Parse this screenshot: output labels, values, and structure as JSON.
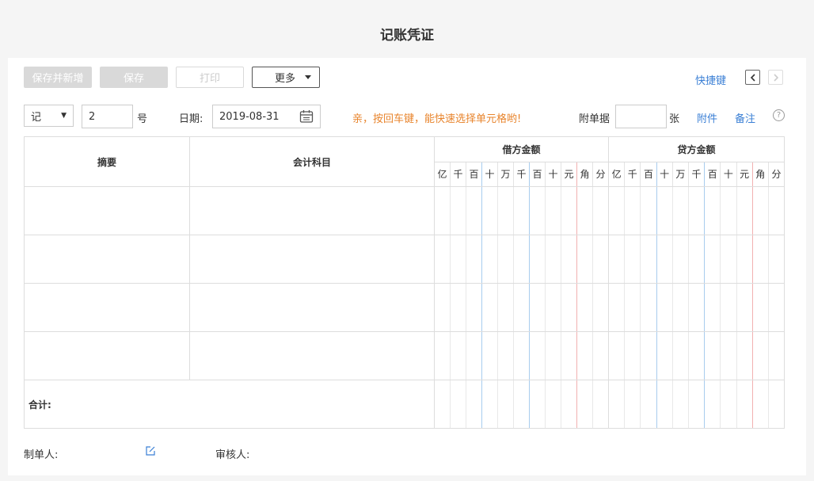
{
  "page": {
    "title": "记账凭证"
  },
  "toolbar": {
    "save_new_label": "保存并新增",
    "save_label": "保存",
    "print_label": "打印",
    "more_label": "更多",
    "shortcut_label": "快捷键"
  },
  "voucher": {
    "type_value": "记",
    "number_value": "2",
    "number_suffix": "号",
    "date_label": "日期:",
    "date_value": "2019-08-31",
    "hint": "亲，按回车键，能快速选择单元格哟!",
    "attachment_label": "附单据",
    "attachment_unit": "张",
    "attachment_link": "附件",
    "note_link": "备注",
    "help_symbol": "?"
  },
  "table": {
    "summary_header": "摘要",
    "subject_header": "会计科目",
    "debit_header": "借方金额",
    "credit_header": "贷方金额",
    "digit_units": [
      "亿",
      "千",
      "百",
      "十",
      "万",
      "千",
      "百",
      "十",
      "元",
      "角",
      "分"
    ],
    "total_label": "合计:",
    "row_count": 4
  },
  "footer": {
    "maker_label": "制单人:",
    "reviewer_label": "审核人:"
  },
  "colors": {
    "link": "#3a7fd5",
    "hint": "#e8842c",
    "divider_blue": "#a8ccee",
    "divider_red": "#f2b1b1"
  }
}
